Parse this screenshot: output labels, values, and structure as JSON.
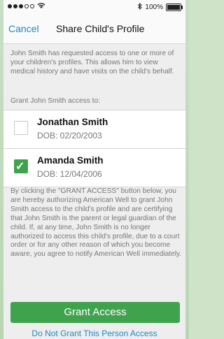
{
  "status_bar": {
    "signal_icon": "signal-dots-icon",
    "wifi_icon": "wifi-icon",
    "bluetooth_icon": "bluetooth-icon",
    "battery_text": "100%",
    "battery_icon": "battery-icon"
  },
  "nav": {
    "cancel_label": "Cancel",
    "title": "Share Child's Profile"
  },
  "intro_text": "John Smith has requested access to one or more of your children's profiles. This allows him to view medical history and have visits on the child's behalf.",
  "grant_label": "Grant John Smith access to:",
  "children": [
    {
      "name": "Jonathan Smith",
      "dob": "DOB: 02/20/2003",
      "checked": false
    },
    {
      "name": "Amanda Smith",
      "dob": "DOB: 12/04/2006",
      "checked": true
    }
  ],
  "legal_text": "By clicking the \"GRANT ACCESS\" button below, you are hereby authorizing American Well to grant John Smith access to the child's profile and are certifying that John Smith is the parent or legal guardian of the child. If, at any time, John Smith is no longer authorized to access this child's profile, due to a court order or for any other reason of which you become aware, you agree to notify American Well immediately.",
  "actions": {
    "grant_label": "Grant Access",
    "deny_label": "Do Not Grant This Person Access"
  },
  "colors": {
    "accent_blue": "#1e88c7",
    "grant_green": "#3fa34d"
  }
}
